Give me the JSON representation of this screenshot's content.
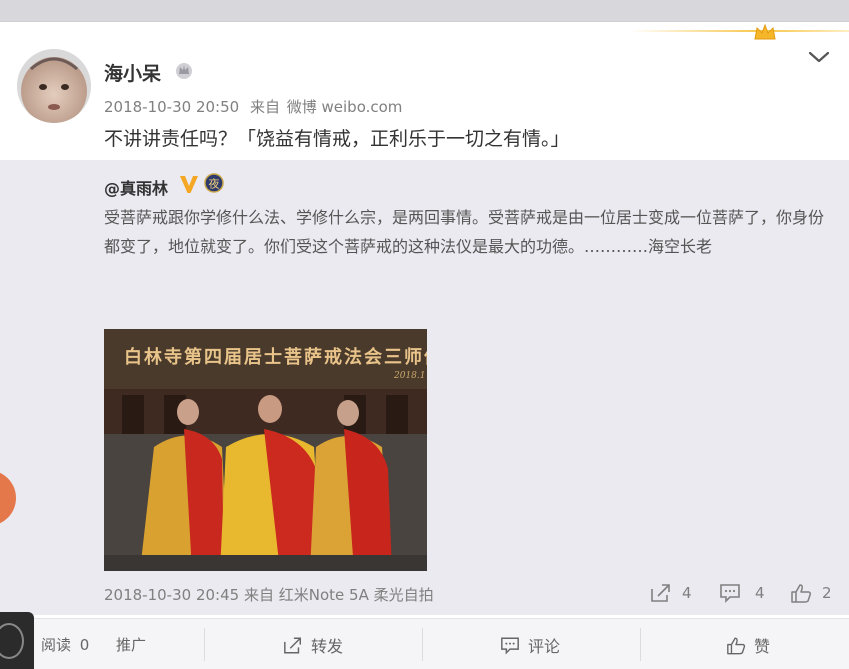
{
  "post": {
    "username": "海小呆",
    "timestamp": "2018-10-30 20:50",
    "source_prefix": "来自",
    "source": "微博 weibo.com",
    "text": "不讲讲责任吗？「饶益有情戒，正利乐于一切之有情。」"
  },
  "repost": {
    "author": "@真雨林",
    "text": "受菩萨戒跟你学修什么法、学修什么宗，是两回事情。受菩萨戒是由一位居士变成一位菩萨了，你身份都变了，地位就变了。你们受这个菩萨戒的这种法仪是最大的功德。…………海空长老",
    "photo_caption": "白林寺第四届居士菩萨戒法会三师像",
    "photo_year": "2018.1",
    "timestamp": "2018-10-30 20:45",
    "source_prefix": "来自",
    "source": "红米Note 5A 柔光自拍",
    "shares": "4",
    "comments": "4",
    "likes": "2"
  },
  "footer": {
    "read_label": "阅读",
    "read_count": "0",
    "promote": "推广",
    "forward": "转发",
    "comment": "评论",
    "like": "赞"
  },
  "colors": {
    "accent_gold": "#f7c64a",
    "vip_orange": "#f5a623",
    "muted_text": "#808080",
    "repost_bg": "#eaeaf0"
  }
}
